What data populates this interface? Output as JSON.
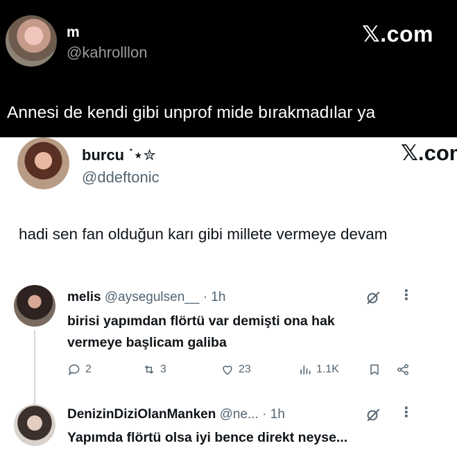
{
  "quoted_post": {
    "display_name": "m",
    "handle": "@kahrolllon",
    "brand": "𝕏.com",
    "text": "Annesi de kendi gibi unprof mide bırakmadılar ya"
  },
  "main_post": {
    "display_name": "burcu ˙⋆✮",
    "handle": "@ddeftonic",
    "brand": "𝕏.com",
    "text": "hadi sen fan olduğun karı gibi millete vermeye devam"
  },
  "replies": [
    {
      "display_name": "melis",
      "handle": "@aysegulsen__",
      "time": "· 1h",
      "text": "birisi yapımdan flörtü var demişti ona hak vermeye başlicam galiba",
      "actions": {
        "replies": "2",
        "reposts": "3",
        "likes": "23",
        "views": "1.1K"
      }
    },
    {
      "display_name": "DenizinDiziOlanManken",
      "handle": "@ne...",
      "time": "· 1h",
      "text": "Yapımda flörtü olsa iyi bence direkt neyse..."
    }
  ],
  "icons": {
    "grok": "grok-icon",
    "more": "more-icon",
    "reply": "reply-icon",
    "repost": "repost-icon",
    "like": "like-icon",
    "views": "views-icon",
    "bookmark": "bookmark-icon",
    "share": "share-icon"
  },
  "colors": {
    "dark_bg": "#000000",
    "text_primary": "#0f1419",
    "text_secondary": "#536471"
  }
}
